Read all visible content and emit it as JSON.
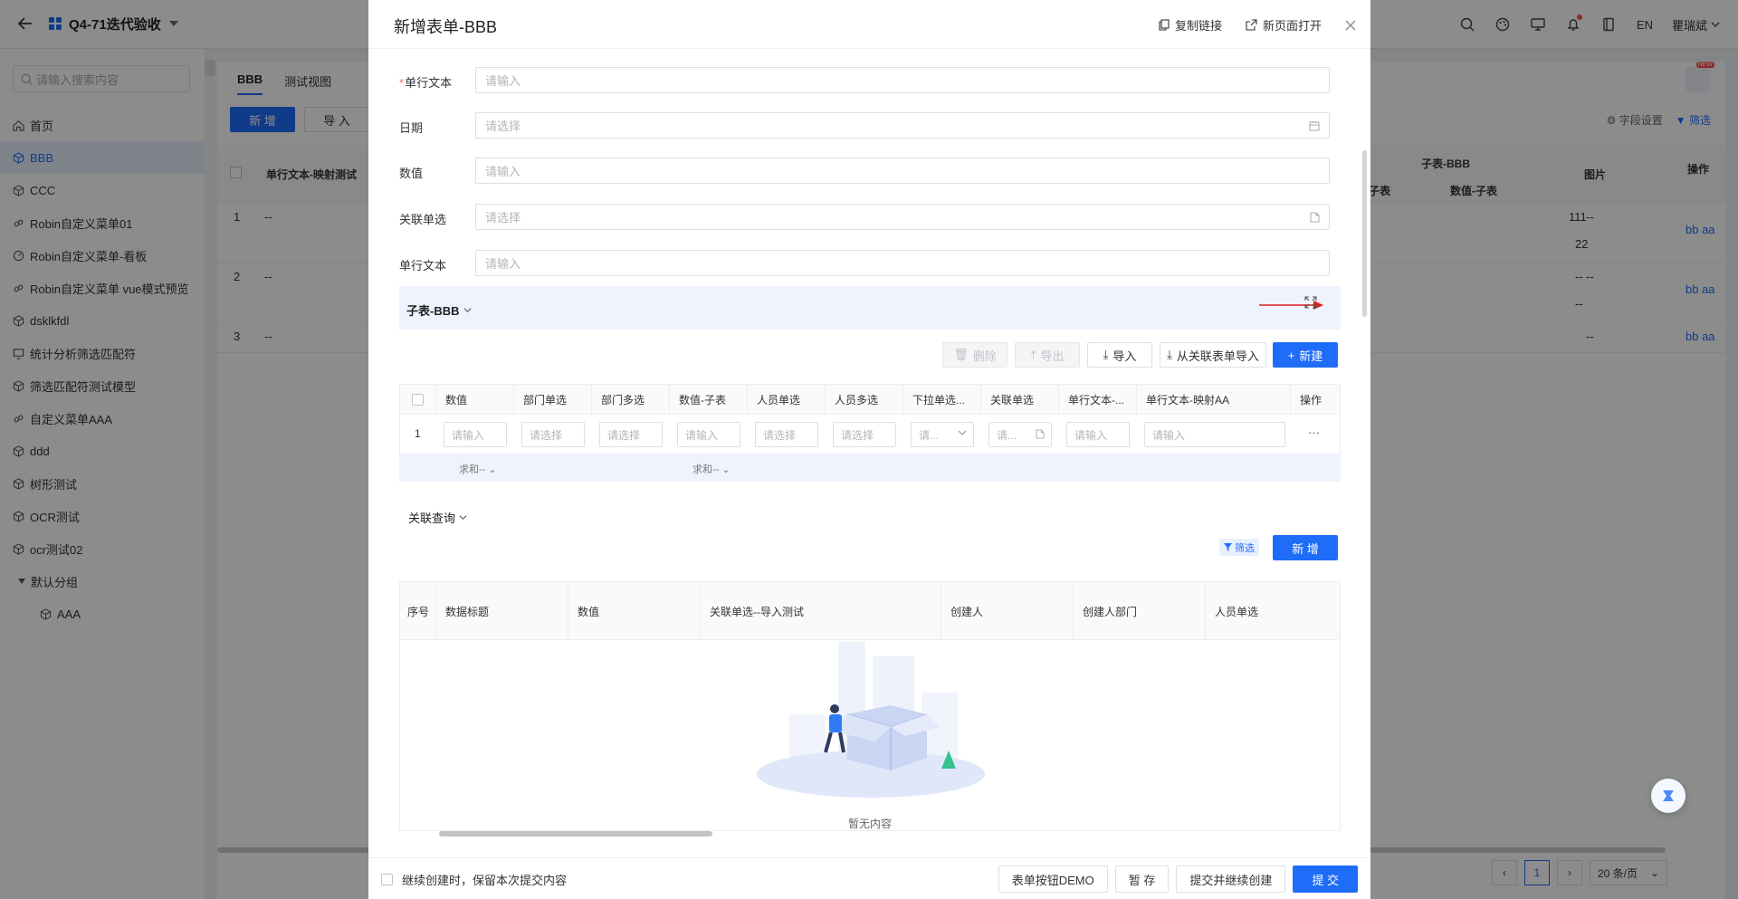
{
  "app": {
    "title": "Q4-71迭代验收",
    "lang": "EN",
    "user": "瞿瑞斌"
  },
  "sidebar": {
    "search_placeholder": "请输入搜索内容",
    "items": [
      {
        "label": "首页",
        "icon": "home-icon"
      },
      {
        "label": "BBB",
        "icon": "cube-icon",
        "active": true
      },
      {
        "label": "CCC",
        "icon": "cube-icon"
      },
      {
        "label": "Robin自定义菜单01",
        "icon": "link-icon"
      },
      {
        "label": "Robin自定义菜单-看板",
        "icon": "dashboard-icon"
      },
      {
        "label": "Robin自定义菜单 vue模式预览",
        "icon": "link-icon"
      },
      {
        "label": "dsklkfdl",
        "icon": "cube-icon"
      },
      {
        "label": "统计分析筛选匹配符",
        "icon": "chart-icon"
      },
      {
        "label": "筛选匹配符测试模型",
        "icon": "cube-icon"
      },
      {
        "label": "自定义菜单AAA",
        "icon": "link-icon"
      },
      {
        "label": "ddd",
        "icon": "cube-icon"
      },
      {
        "label": "树形测试",
        "icon": "cube-icon"
      },
      {
        "label": "OCR测试",
        "icon": "cube-icon"
      },
      {
        "label": "ocr测试02",
        "icon": "cube-icon"
      }
    ],
    "group": {
      "label": "默认分组",
      "children": [
        {
          "label": "AAA"
        }
      ]
    }
  },
  "background": {
    "tabs": [
      "BBB",
      "测试视图"
    ],
    "add_btn": "新 增",
    "import_btn": "导 入",
    "field_settings": "字段设置",
    "filter": "筛选",
    "new_badge": "NEW",
    "col_text_mapping": "单行文本-映射测试",
    "col_sub_group": "子表-BBB",
    "col_sub_a": "-子表",
    "col_sub_b": "数值-子表",
    "col_image": "图片",
    "col_ops": "操作",
    "rows": [
      {
        "idx": "1",
        "text": "--",
        "num1": "111",
        "num2": "22",
        "img": "--",
        "ops": "bb  aa"
      },
      {
        "idx": "2",
        "text": "--",
        "num1": "--",
        "num2": "--",
        "img": "--",
        "ops": "bb  aa"
      },
      {
        "idx": "3",
        "text": "--",
        "img": "--",
        "ops": "bb  aa"
      }
    ],
    "pager": {
      "page": "1",
      "size": "20 条/页"
    }
  },
  "dialog": {
    "title": "新增表单-BBB",
    "copy_link": "复制链接",
    "open_new": "新页面打开",
    "fields": [
      {
        "label": "单行文本",
        "required": true,
        "placeholder": "请输入"
      },
      {
        "label": "日期",
        "placeholder": "请选择",
        "suffix": "calendar-icon"
      },
      {
        "label": "数值",
        "placeholder": "请输入"
      },
      {
        "label": "关联单选",
        "placeholder": "请选择",
        "suffix": "document-icon"
      },
      {
        "label": "单行文本",
        "placeholder": "请输入"
      }
    ],
    "subtable": {
      "name": "子表-BBB",
      "buttons": {
        "delete": "删除",
        "export": "导出",
        "import": "导入",
        "import_rel": "从关联表单导入",
        "create": "新建"
      },
      "columns": [
        "数值",
        "部门单选",
        "部门多选",
        "数值-子表",
        "人员单选",
        "人员多选",
        "下拉单选...",
        "关联单选",
        "单行文本-...",
        "单行文本-映射AA",
        "操作"
      ],
      "row": {
        "index": "1",
        "cells": [
          "请输入",
          "请选择",
          "请选择",
          "请输入",
          "请选择",
          "请选择",
          "请...",
          "请...",
          "请输入",
          "请输入"
        ],
        "more": "···"
      },
      "sum_label_1": "求和--",
      "sum_label_2": "求和--"
    },
    "relation": {
      "title": "关联查询",
      "filter": "筛选",
      "add": "新 增",
      "columns": [
        "序号",
        "数据标题",
        "数值",
        "关联单选--导入测试",
        "创建人",
        "创建人部门",
        "人员单选"
      ],
      "empty": "暂无内容"
    },
    "footer": {
      "keep": "继续创建时，保留本次提交内容",
      "demo": "表单按钮DEMO",
      "save": "暂 存",
      "submit_continue": "提交并继续创建",
      "submit": "提 交"
    }
  },
  "colors": {
    "primary": "#1e6cf8",
    "danger": "#f56c6c",
    "arrow": "#e02020"
  }
}
